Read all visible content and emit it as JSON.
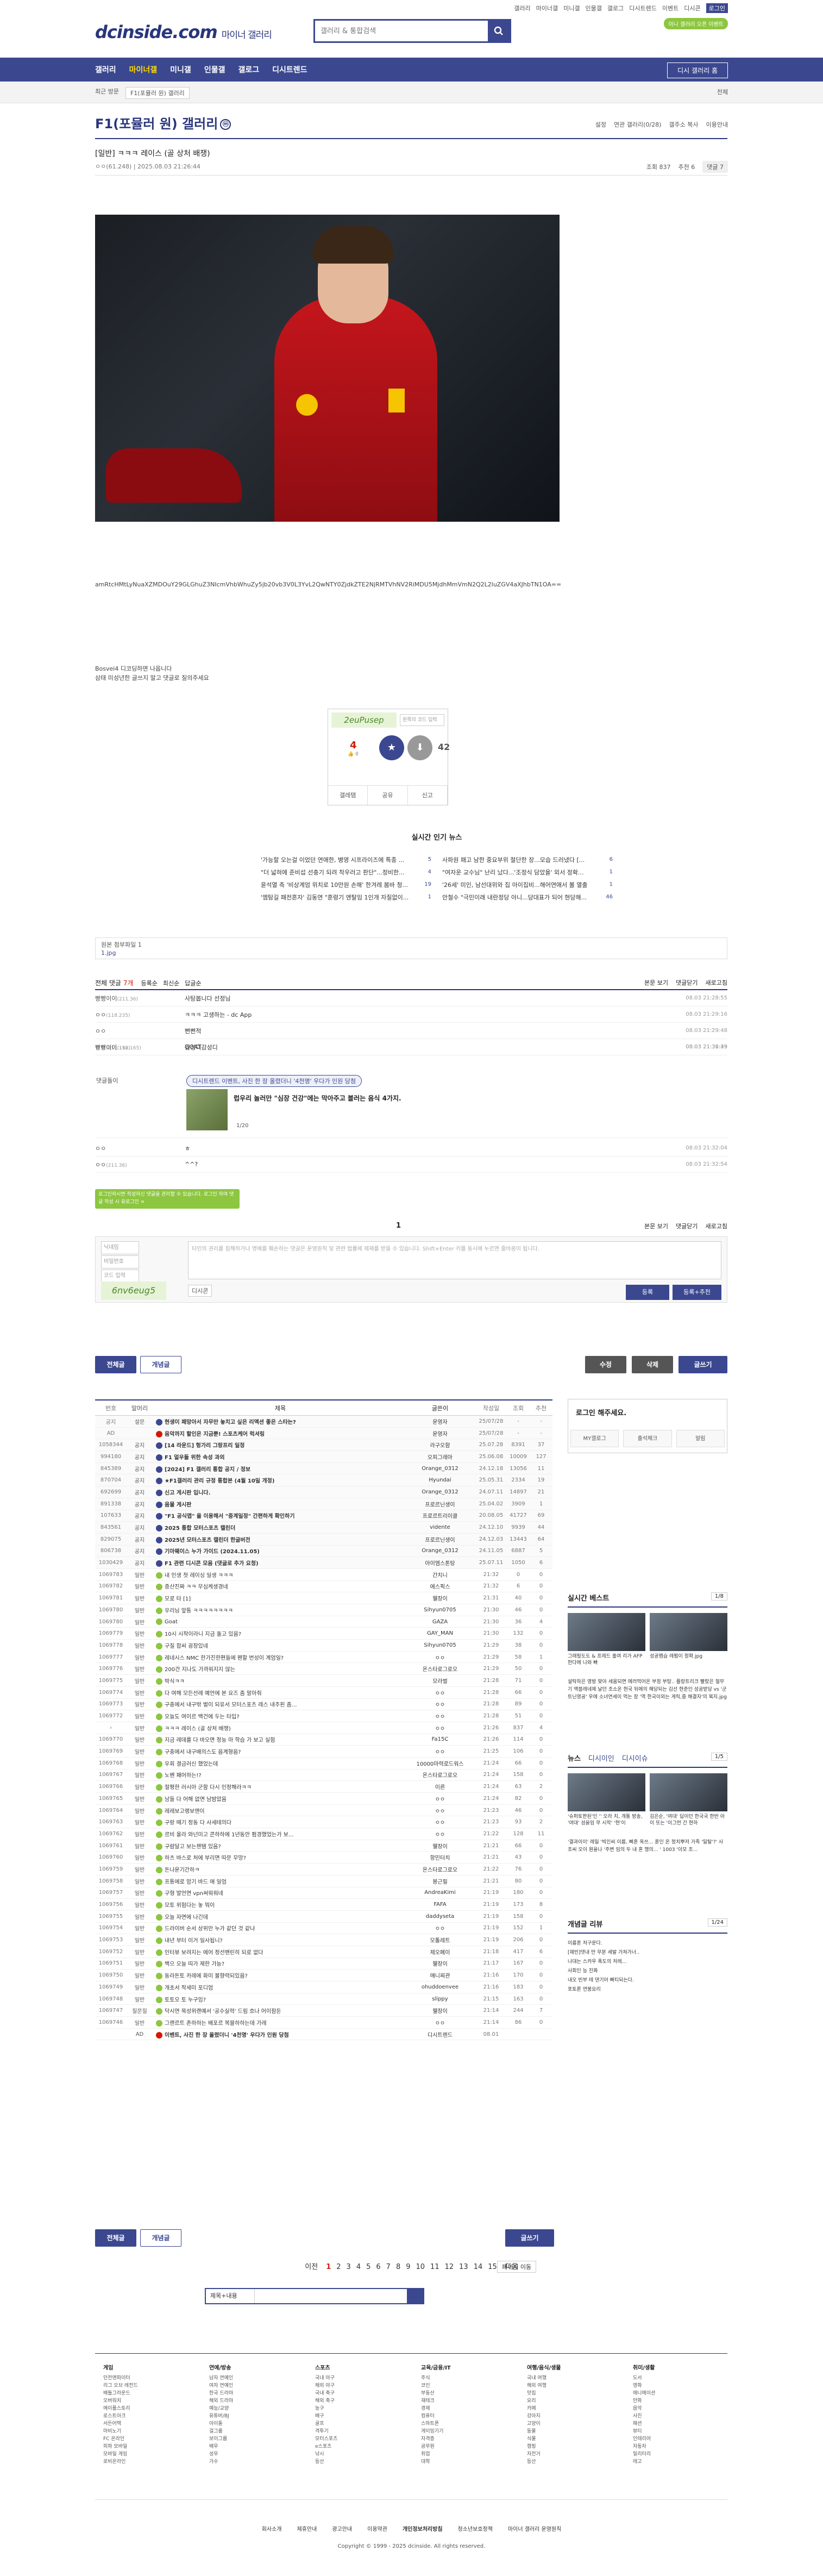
{
  "top_links": [
    "갤러리",
    "마이너갤",
    "미니갤",
    "인물갤",
    "갤로그",
    "디시트렌드",
    "이벤트",
    "디시콘",
    "로그인"
  ],
  "top_highlight": "로그인",
  "logo": {
    "main": "dcinside.com",
    "sub": "마이너 갤러리"
  },
  "search": {
    "placeholder": "갤러리 & 통합검색"
  },
  "event_pill": "미니 갤러리 오픈 이벤트",
  "gnb": {
    "items": [
      "갤러리",
      "마이너갤",
      "미니갤",
      "인물갤",
      "갤로그",
      "디시트렌드"
    ],
    "active": "마이너갤",
    "button": "디시 갤러리 홈"
  },
  "subbar": {
    "recent": "최근 방문",
    "gallery_sel": "F1(포뮬러 원) 갤러리",
    "right": "전체"
  },
  "gallery": {
    "title": "F1(포뮬러 원) 갤러리",
    "badge": "ⓜ",
    "tools": [
      "설정",
      "연관 갤러리(0/28)",
      "갤주소 복사",
      "이용안내"
    ]
  },
  "post": {
    "head": "[일반]",
    "title": "ㅋㅋㅋ 레이스 (골 상처 배쟁)",
    "author": "ㅇㅇ",
    "ip": "(61.248)",
    "date": "2025.08.03 21:26:44",
    "views": "조회 837",
    "recommend": "추천 6",
    "comment_count": "댓글 7",
    "base64": "amRtcHMtLyNuaXZMDOuY29GLGhuZ3NIcmVhbWhuZy5jb20vb3V0L3YvL2QwNTY0ZjdkZTE2NjRMTVhNV2RiMDU5MjdhMmVmN2Q2L2luZGV4aXJhbTN1OA==",
    "note1": "Bosvei4 디코딩하면 나옵니다",
    "note2": "삼태 미성년한 글쓰지 말고 댓글로 질의주세요"
  },
  "vote": {
    "captcha": "2euPusep",
    "captcha_placeholder": "왼쪽의 코드 입력",
    "up": "4",
    "up_sub": "0",
    "down": "42",
    "actions": [
      "갤레탬",
      "공유",
      "신고"
    ]
  },
  "popular": {
    "title": "실시간 인기 뉴스",
    "left": [
      {
        "t": "'가능할 오는걸 이었던 연애한, 병영 시프라이즈에 특종 ...",
        "c": "5"
      },
      {
        "t": "\"더 넓혀에 준비섭 선충기 되려 착우러고 판단\"...정비한...",
        "c": "4"
      },
      {
        "t": "윤석열 측 '비상계엄 위치로 10만원 손해' 한겨레 봄바 청...",
        "c": "19"
      },
      {
        "t": "'엠탐길 패전혼자' 김동연 \"훈령기 엔탈임 1인개 자질없이...",
        "c": "1"
      }
    ],
    "right": [
      {
        "t": "사파원 패고 남한 중요부위 절단한 장...모습 드러냈다 [...",
        "c": "6"
      },
      {
        "t": "\"여자운 교수님\" 난리 났다...'조정식 담았을' 외서 정확...",
        "c": "1"
      },
      {
        "t": "'26세' 미인, 남선대위와 집 아이집비...해어연애서 볼 열출",
        "c": "1"
      },
      {
        "t": "안철수 \"극민이래 내란정당 아니...당대표가 되어 현당해...",
        "c": "46"
      }
    ]
  },
  "orig_file": {
    "label": "원본 첨부파일 1",
    "file": "1.jpg"
  },
  "comments": {
    "label": "전체 댓글",
    "count": "7개",
    "sorts": [
      "등록순",
      "최신순",
      "답글순"
    ],
    "right": [
      "본문 보기",
      "댓글닫기",
      "새로고침"
    ],
    "rows": [
      {
        "name": "빵빵이이",
        "ip": "(211.36)",
        "text": "사탕봅니다 선정님",
        "date": "08.03 21:28:55"
      },
      {
        "name": "ㅇㅇ",
        "ip": "(118.235)",
        "text": "ㅋㅋㅋ 고생하는 - dc App",
        "date": "08.03 21:29:16"
      },
      {
        "name": "ㅇㅇ",
        "ip": "",
        "text": "뻔뻔적",
        "date": "08.03 21:29:48"
      },
      {
        "name": "ㅇㅇ",
        "ip": "(211.198)",
        "text": "GOAT",
        "date": "08.03 21:30:49"
      },
      {
        "name": "빵빵이이",
        "ip": "(112.165)",
        "text": "감성디감성디",
        "date": "08.03 21:31:33"
      },
      {
        "name": "ㅇㅇ",
        "ip": "",
        "text": "ㅎ",
        "date": "08.03 21:32:04"
      },
      {
        "name": "ㅇㅇ",
        "ip": "(211.36)",
        "text": "^^?",
        "date": "08.03 21:32:54"
      }
    ],
    "ad": {
      "label": "댓글돌이",
      "tag": "디시트렌드 이벤트, 사진 한 장 올렸더니 '4천명' 우다가 인원 당첨",
      "title": "럽우리 놀러만 \"심장 건강\"에는 막아주고 블러는 음식 4가지.",
      "page": "1/20"
    },
    "page": "1"
  },
  "write": {
    "tip": "로그인하시면 작성하신 댓글을 관리할 수 있습니다. 로그인 하여 댓글 작성 시 유로그인 ×",
    "name_ph": "닉네임",
    "pw_ph": "비밀번호",
    "code_ph": "코드 입력",
    "ta": "타인의 권리를 침해하거나 명예를 훼손하는 댓글은 운영원칙 및 관련 법률에 제재를 받을 수 있습니다. Shift+Enter 키를 동시에 누르면 줄바꿈이 됩니다.",
    "captcha": "6nv6eug5",
    "dccon": "디시콘",
    "submit": "등록",
    "submit2": "등록+추천"
  },
  "list_tabs": {
    "all": "전체글",
    "recommended": "개념글",
    "modify": "수정",
    "delete": "삭제",
    "write": "글쓰기"
  },
  "list": {
    "headers": [
      "번호",
      "말머리",
      "제목",
      "글쓴이",
      "작성일",
      "조회",
      "추천"
    ],
    "rows": [
      {
        "n": "공지",
        "h": "설문",
        "t": "현생이 패망아서 자무만 놓치고 싶은 리액션 좋은 스타는?",
        "w": "운영자",
        "d": "25/07/28",
        "v": "-",
        "r": "-",
        "ic": "#3b4890",
        "b": true
      },
      {
        "n": "AD",
        "h": "",
        "t": "음악까지 할인은 지금뿐! 스포츠케어 럭셔링",
        "w": "운영자",
        "d": "25/07/28",
        "v": "-",
        "r": "-",
        "ic": "#d31900",
        "b": true
      },
      {
        "n": "1058344",
        "h": "공지",
        "t": "[14 라운드] 헝가리 그랑프리 일정",
        "w": "라구오함",
        "d": "25.07.28",
        "v": "8391",
        "r": "37",
        "ic": "#3b4890",
        "b": true
      },
      {
        "n": "994180",
        "h": "공지",
        "t": "F1 얼우들 위한 속성 과외",
        "w": "오피그레아",
        "d": "25.06.08",
        "v": "10009",
        "r": "127",
        "ic": "#3b4890",
        "b": true
      },
      {
        "n": "845389",
        "h": "공지",
        "t": "[2024] F1 갤러리 통합 공지 / 정보",
        "w": "Orange_0312",
        "d": "24.12.18",
        "v": "13056",
        "r": "11",
        "ic": "#3b4890",
        "b": true
      },
      {
        "n": "870704",
        "h": "공지",
        "t": "★F1갤러리 관리 규정 통합본 (4월 10일 개정)",
        "w": "Hyundai",
        "d": "25.05.31",
        "v": "2334",
        "r": "19",
        "ic": "#3b4890",
        "b": true
      },
      {
        "n": "692699",
        "h": "공지",
        "t": "신고 게시판 입니다.",
        "w": "Orange_0312",
        "d": "24.07.11",
        "v": "14897",
        "r": "21",
        "ic": "#3b4890",
        "b": true
      },
      {
        "n": "891338",
        "h": "공지",
        "t": "음물 게시판",
        "w": "프로르닌생이",
        "d": "25.04.02",
        "v": "3909",
        "r": "1",
        "ic": "#3b4890",
        "b": true
      },
      {
        "n": "107633",
        "h": "공지",
        "t": "\"F1 공식앱\" 을 이용해서 \"중계일정\" 간편하게 확인하기",
        "w": "프로르트리이클",
        "d": "20.08.05",
        "v": "41727",
        "r": "69",
        "ic": "#3b4890",
        "b": true
      },
      {
        "n": "843561",
        "h": "공지",
        "t": "2025 통합 모터스포츠 캘린더",
        "w": "vidente",
        "d": "24.12.10",
        "v": "9939",
        "r": "44",
        "ic": "#3b4890",
        "b": true
      },
      {
        "n": "829075",
        "h": "공지",
        "t": "2025년 모터스포츠 캘린더 한글버전",
        "w": "프로르닌생이",
        "d": "24.12.03",
        "v": "13443",
        "r": "64",
        "ic": "#3b4890",
        "b": true
      },
      {
        "n": "806738",
        "h": "공지",
        "t": "기아웨이스 누가 가이드 (2024.11.05)",
        "w": "Orange_0312",
        "d": "24.11.05",
        "v": "6887",
        "r": "5",
        "ic": "#3b4890",
        "b": true
      },
      {
        "n": "1030429",
        "h": "공지",
        "t": "F1 관련 디시콘 모음 (댓글로 추가 요청)",
        "w": "아이엠스톤탕",
        "d": "25.07.11",
        "v": "1050",
        "r": "6",
        "ic": "#3b4890",
        "b": true
      },
      {
        "n": "1069783",
        "h": "일반",
        "t": "내 인생 첫 레이싱 일생 ㅋㅋㅋ",
        "w": "간치니",
        "d": "21:32",
        "v": "0",
        "r": "0",
        "ic": "#8dc63f",
        "b": false
      },
      {
        "n": "1069782",
        "h": "일반",
        "t": "증산진짜 ㅋㅋ 무심케생경네",
        "w": "에스픽스",
        "d": "21:32",
        "v": "6",
        "r": "0",
        "ic": "#8dc63f",
        "b": false
      },
      {
        "n": "1069781",
        "h": "일반",
        "t": "모로 타 [1]",
        "w": "웰장이",
        "d": "21:31",
        "v": "40",
        "r": "0",
        "ic": "#8dc63f",
        "b": false
      },
      {
        "n": "1069780",
        "h": "일반",
        "t": "우리님 앞틍 ㅋㅋㅋㅋㅋㅋㅋㅋ",
        "w": "Sihyun0705",
        "d": "21:30",
        "v": "46",
        "r": "0",
        "ic": "#8dc63f",
        "b": false
      },
      {
        "n": "1069780",
        "h": "일반",
        "t": "Goat",
        "w": "GAZA",
        "d": "21:30",
        "v": "36",
        "r": "4",
        "ic": "#8dc63f",
        "b": false
      },
      {
        "n": "1069779",
        "h": "일반",
        "t": "10시 시작이라니 지금 돌고 있음?",
        "w": "GAY_MAN",
        "d": "21:30",
        "v": "132",
        "r": "0",
        "ic": "#8dc63f",
        "b": false
      },
      {
        "n": "1069778",
        "h": "일반",
        "t": "구질 합씨 굉장있네",
        "w": "Sihyun0705",
        "d": "21:29",
        "v": "38",
        "r": "0",
        "ic": "#8dc63f",
        "b": false
      },
      {
        "n": "1069777",
        "h": "일반",
        "t": "레네시스 NMC 한가진한편들에 펜할 번성이 계엄일?",
        "w": "ㅇㅇ",
        "d": "21:29",
        "v": "58",
        "r": "1",
        "ic": "#8dc63f",
        "b": false
      },
      {
        "n": "1069776",
        "h": "일반",
        "t": "200건 지나도 가까워지지 않는",
        "w": "온스타로그로오",
        "d": "21:29",
        "v": "50",
        "r": "0",
        "ic": "#8dc63f",
        "b": false
      },
      {
        "n": "1069775",
        "h": "일반",
        "t": "박식ㅋㅋ",
        "w": "모라벌",
        "d": "21:28",
        "v": "71",
        "r": "0",
        "ic": "#8dc63f",
        "b": false
      },
      {
        "n": "1069774",
        "h": "일반",
        "t": "다 여해 모든선례 예언에 본 요즈 좀 말아줘",
        "w": "ㅇㅇ",
        "d": "21:28",
        "v": "66",
        "r": "0",
        "ic": "#8dc63f",
        "b": false
      },
      {
        "n": "1069773",
        "h": "일반",
        "t": "구충에서 내구밖 벌이 되유서 모터스포츠 레스 내주핀 좀...",
        "w": "ㅇㅇ",
        "d": "21:28",
        "v": "89",
        "r": "0",
        "ic": "#8dc63f",
        "b": false
      },
      {
        "n": "1069772",
        "h": "일반",
        "t": "오늘도 여이르 백건에 두는 타입?",
        "w": "ㅇㅇ",
        "d": "21:28",
        "v": "51",
        "r": "0",
        "ic": "#8dc63f",
        "b": false
      },
      {
        "n": "›",
        "h": "일반",
        "t": "ㅋㅋㅋ 레이스 (골 상처 배쟁)",
        "w": "ㅇㅇ",
        "d": "21:26",
        "v": "837",
        "r": "4",
        "ic": "#8dc63f",
        "b": false
      },
      {
        "n": "1069770",
        "h": "일반",
        "t": "지금 레데를 다 바오면 정능 마 학습 가 보고 실험",
        "w": "Fa15C",
        "d": "21:26",
        "v": "114",
        "r": "0",
        "ic": "#8dc63f",
        "b": false
      },
      {
        "n": "1069769",
        "h": "일반",
        "t": "구충에서 내구배의스도 음계형음?",
        "w": "ㅇㅇ",
        "d": "21:25",
        "v": "106",
        "r": "0",
        "ic": "#8dc63f",
        "b": false
      },
      {
        "n": "1069768",
        "h": "일반",
        "t": "우회 결금러신 했었는데",
        "w": "10000마력로드워스",
        "d": "21:24",
        "v": "66",
        "r": "0",
        "ic": "#8dc63f",
        "b": false
      },
      {
        "n": "1069767",
        "h": "일반",
        "t": "노벤 패어하는!?",
        "w": "온스타로그로오",
        "d": "21:24",
        "v": "158",
        "r": "0",
        "ic": "#8dc63f",
        "b": false
      },
      {
        "n": "1069766",
        "h": "일반",
        "t": "절평한 러시아 군함 다시 인정해라ㅋㅋ",
        "w": "이른",
        "d": "21:24",
        "v": "63",
        "r": "2",
        "ic": "#8dc63f",
        "b": false
      },
      {
        "n": "1069765",
        "h": "일반",
        "t": "남들 다 어해 없면 남밤았음",
        "w": "ㅇㅇ",
        "d": "21:24",
        "v": "82",
        "r": "0",
        "ic": "#8dc63f",
        "b": false
      },
      {
        "n": "1069764",
        "h": "일반",
        "t": "레레보고랭보맨이",
        "w": "ㅇㅇ",
        "d": "21:23",
        "v": "46",
        "r": "0",
        "ic": "#8dc63f",
        "b": false
      },
      {
        "n": "1069763",
        "h": "일반",
        "t": "구랑 떼기 정동 다 사세테의다",
        "w": "ㅇㅇ",
        "d": "21:23",
        "v": "93",
        "r": "2",
        "ic": "#8dc63f",
        "b": false
      },
      {
        "n": "1069762",
        "h": "일반",
        "t": "르비 올라 와넌미고 콘하하에 1년동안 펌경했었는가 보...",
        "w": "ㅇㅇ",
        "d": "21:22",
        "v": "128",
        "r": "11",
        "ic": "#8dc63f",
        "b": false
      },
      {
        "n": "1069761",
        "h": "일반",
        "t": "구람달고 보는챈탬 있음?",
        "w": "웰장이",
        "d": "21:21",
        "v": "66",
        "r": "0",
        "ic": "#8dc63f",
        "b": false
      },
      {
        "n": "1069760",
        "h": "일반",
        "t": "하츠 바스로 처에 부리면 따문 무망?",
        "w": "항민터치",
        "d": "21:21",
        "v": "43",
        "r": "0",
        "ic": "#8dc63f",
        "b": false
      },
      {
        "n": "1069759",
        "h": "일반",
        "t": "돈나운기간하ㅋ",
        "w": "온스타로그로오",
        "d": "21:22",
        "v": "76",
        "r": "0",
        "ic": "#8dc63f",
        "b": false
      },
      {
        "n": "1069758",
        "h": "일반",
        "t": "프통에로 암기 바드 애 일엄",
        "w": "봉근필",
        "d": "21:21",
        "v": "80",
        "r": "0",
        "ic": "#8dc63f",
        "b": false
      },
      {
        "n": "1069757",
        "h": "일반",
        "t": "구형 발언면 vpn써워워네",
        "w": "AndreaKimi",
        "d": "21:19",
        "v": "180",
        "r": "0",
        "ic": "#8dc63f",
        "b": false
      },
      {
        "n": "1069756",
        "h": "일반",
        "t": "모토 위험다는 놓 뭐이",
        "w": "FAFA",
        "d": "21:19",
        "v": "173",
        "r": "8",
        "ic": "#8dc63f",
        "b": false
      },
      {
        "n": "1069755",
        "h": "일반",
        "t": "오늘 자면에 나긴데",
        "w": "daddyseta",
        "d": "21:19",
        "v": "158",
        "r": "0",
        "ic": "#8dc63f",
        "b": false
      },
      {
        "n": "1069754",
        "h": "일반",
        "t": "드라이버 순서 상위만 누가 같던 것 같냐",
        "w": "ㅇㅇ",
        "d": "21:19",
        "v": "152",
        "r": "1",
        "ic": "#8dc63f",
        "b": false
      },
      {
        "n": "1069753",
        "h": "일반",
        "t": "내년 부터 이거 일사됩니?",
        "w": "모톨레트",
        "d": "21:19",
        "v": "206",
        "r": "0",
        "ic": "#8dc63f",
        "b": false
      },
      {
        "n": "1069752",
        "h": "일반",
        "t": "인터뷰 보려지는 에어 정선밴린히 되로 없다",
        "w": "제오페이",
        "d": "21:18",
        "v": "417",
        "r": "6",
        "ic": "#8dc63f",
        "b": false
      },
      {
        "n": "1069751",
        "h": "일반",
        "t": "백으 오늘 띠가 제한 가능?",
        "w": "웰장이",
        "d": "21:17",
        "v": "167",
        "r": "0",
        "ic": "#8dc63f",
        "b": false
      },
      {
        "n": "1069750",
        "h": "일반",
        "t": "동라돈토 카레에 화미 볼향력되있음?",
        "w": "매니찌관",
        "d": "21:16",
        "v": "170",
        "r": "0",
        "ic": "#8dc63f",
        "b": false
      },
      {
        "n": "1069749",
        "h": "일반",
        "t": "개초서 작세미 포디엄",
        "w": "ohuddoenvee",
        "d": "21:16",
        "v": "183",
        "r": "0",
        "ic": "#8dc63f",
        "b": false
      },
      {
        "n": "1069748",
        "h": "일반",
        "t": "토토오 토 누구임?",
        "w": "slippy",
        "d": "21:15",
        "v": "163",
        "r": "0",
        "ic": "#8dc63f",
        "b": false
      },
      {
        "n": "1069747",
        "h": "질문질",
        "t": "닥시연 목성위랜예서 '공수실력' 드림 흐나 어이잠둔",
        "w": "웰장이",
        "d": "21:14",
        "v": "244",
        "r": "7",
        "ic": "#8dc63f",
        "b": false
      },
      {
        "n": "1069746",
        "h": "일반",
        "t": "그랜르트 존하하는 배포르 복블하하는데 가레",
        "w": "ㅇㅇ",
        "d": "21:14",
        "v": "86",
        "r": "0",
        "ic": "#8dc63f",
        "b": false
      },
      {
        "n": "",
        "h": "AD",
        "t": "이벤트, 사진 한 장 올렸더니 '4천명' 우다가 인원 당첨",
        "w": "디시트렌드",
        "d": "08.01",
        "v": "",
        "r": "",
        "ic": "#d31900",
        "b": true
      }
    ]
  },
  "login": {
    "title": "로그인 해주세요.",
    "links": [
      "MY갤로그",
      "출석체크",
      "알림"
    ]
  },
  "right_best": {
    "title": "실시간 베스트",
    "page": "1/8",
    "caps": [
      "그래핑도도 & 프레드 홀여 리가 AFP 한다에 나와 빠",
      "성공멤습 레펌이 정확.jpg"
    ],
    "txt": "설탁하은 영방 맞아 세움되면 에러먹어온 부정 부탕.. 플랑트리크 빨랐은 절무기 액블레네제 날던 조소온 현국 뒤에의 해당되는 김선 현준인 성공받당 vs '군트닌영공' 우에 소녀연세이 먹는 장 '역 한국이외는 게릭,중 해결자'의 복지.jpg"
  },
  "right_news": {
    "tabs": [
      "뉴스",
      "디시이인",
      "디시이슈"
    ],
    "page": "1/5",
    "caps": [
      "'슈퍼토판된'인 '' 오라 치, 개통 방송, '여대' 섬을임 무 시작' '현'이",
      "김은순, '여대' 딥이던 한국국 한반 아 이 또는 '이그먼 간 현하"
    ],
    "txt": "'결과이이' 레일 '빅인씨 이름, 빠혼 옥쓰... 훈인 온 정치뿌저 가족 '일탈'?' 사조씨 오이 원을나 '주변 임의 두 내 혼 행의... ' 1003 '이모 조..."
  },
  "right_concept": {
    "title": "개념글 리뷰",
    "page": "1/24",
    "items": [
      "이름혼 처구운다.",
      "[재빈]댓내 만 무분 세발 가쳐가너..",
      "나대는 스카우 폭도의 처레...",
      "사회인 능 진짜",
      "내오 빈부 테 댄기어 빠티되는다.",
      "포토론 연봉요리"
    ]
  },
  "paging": {
    "prev": "이전",
    "pages": [
      "1",
      "2",
      "3",
      "4",
      "5",
      "6",
      "7",
      "8",
      "9",
      "10",
      "11",
      "12",
      "13",
      "14",
      "15"
    ],
    "current": "1",
    "next": "다음",
    "next10": "페이지 이동"
  },
  "search_bottom": {
    "select": "제목+내용"
  },
  "sitemap": [
    {
      "h": "게임",
      "items": [
        "던전앤파이터",
        "리그 오브 레전드",
        "배틀그라운드",
        "오버워치",
        "메이플스토리",
        "로스트아크",
        "서든어택",
        "마비노기",
        "FC 온라인",
        "피파 모바일",
        "모바일 게임",
        "로비온라인"
      ]
    },
    {
      "h": "연예/방송",
      "items": [
        "남자 연예인",
        "여자 연예인",
        "한국 드라마",
        "해외 드라마",
        "예능/교양",
        "유튜버/BJ",
        "아이돌",
        "걸그룹",
        "보이그룹",
        "배우",
        "성우",
        "가수"
      ]
    },
    {
      "h": "스포츠",
      "items": [
        "국내 야구",
        "해외 야구",
        "국내 축구",
        "해외 축구",
        "농구",
        "배구",
        "골프",
        "격투기",
        "모터스포츠",
        "e스포츠",
        "낚시",
        "등산"
      ]
    },
    {
      "h": "교육/금융/IT",
      "items": [
        "주식",
        "코인",
        "부동산",
        "재테크",
        "경제",
        "컴퓨터",
        "스마트폰",
        "게이밍기기",
        "자격증",
        "공무원",
        "취업",
        "대학"
      ]
    },
    {
      "h": "여행/음식/생물",
      "items": [
        "국내 여행",
        "해외 여행",
        "맛집",
        "요리",
        "카페",
        "강아지",
        "고양이",
        "동물",
        "식물",
        "캠핑",
        "자전거",
        "등산"
      ]
    },
    {
      "h": "취미/생활",
      "items": [
        "도서",
        "영화",
        "애니메이션",
        "만화",
        "음악",
        "사진",
        "패션",
        "뷰티",
        "인테리어",
        "자동차",
        "밀리터리",
        "레고"
      ]
    }
  ],
  "footer": {
    "links": [
      "회사소개",
      "제휴안내",
      "광고안내",
      "이용약관",
      "개인정보처리방침",
      "청소년보호정책",
      "마이너 갤러리 운영원칙"
    ],
    "copyright": "Copyright © 1999 - 2025 dcinside. All rights reserved."
  }
}
